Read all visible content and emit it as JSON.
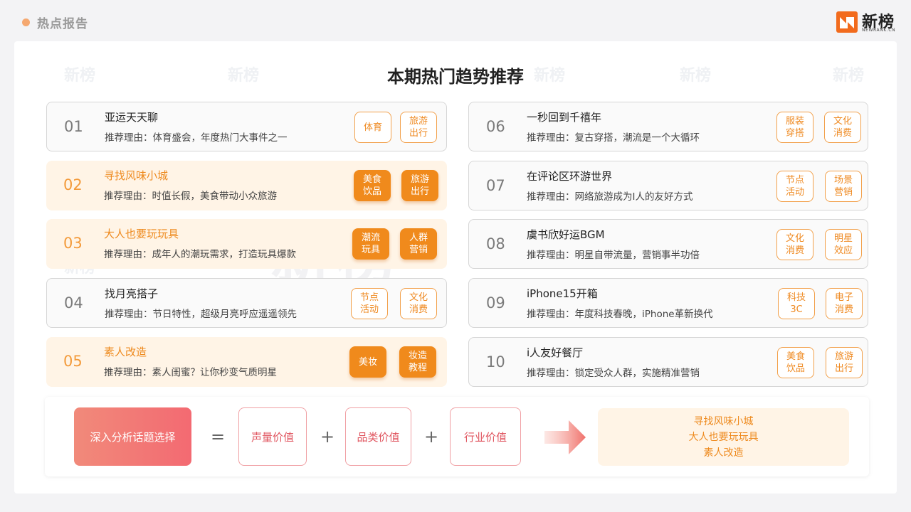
{
  "header": {
    "report_label": "热点报告",
    "logo_cn": "新榜",
    "logo_en": "NEWRANK.CN"
  },
  "watermark": "新榜",
  "title": "本期热门趋势推荐",
  "left_items": [
    {
      "num": "01",
      "topic": "亚运天天聊",
      "reason": "推荐理由：体育盛会，年度热门大事件之一",
      "highlight": false,
      "tags": [
        "体育",
        "旅游\n出行"
      ]
    },
    {
      "num": "02",
      "topic": "寻找风味小城",
      "reason": "推荐理由：时值长假，美食带动小众旅游",
      "highlight": true,
      "tags": [
        "美食\n饮品",
        "旅游\n出行"
      ]
    },
    {
      "num": "03",
      "topic": "大人也要玩玩具",
      "reason": "推荐理由：成年人的潮玩需求，打造玩具爆款",
      "highlight": true,
      "tags": [
        "潮流\n玩具",
        "人群\n营销"
      ]
    },
    {
      "num": "04",
      "topic": "找月亮搭子",
      "reason": "推荐理由：节日特性，超级月亮呼应遥遥领先",
      "highlight": false,
      "tags": [
        "节点\n活动",
        "文化\n消费"
      ]
    },
    {
      "num": "05",
      "topic": "素人改造",
      "reason": "推荐理由：素人闺蜜？让你秒变气质明星",
      "highlight": true,
      "tags": [
        "美妆",
        "妆造\n教程"
      ]
    }
  ],
  "right_items": [
    {
      "num": "06",
      "topic": "一秒回到千禧年",
      "reason": "推荐理由：复古穿搭，潮流是一个大循环",
      "highlight": false,
      "tags": [
        "服装\n穿搭",
        "文化\n消费"
      ]
    },
    {
      "num": "07",
      "topic": "在评论区环游世界",
      "reason": "推荐理由：网络旅游成为I人的友好方式",
      "highlight": false,
      "tags": [
        "节点\n活动",
        "场景\n营销"
      ]
    },
    {
      "num": "08",
      "topic": "虞书欣好运BGM",
      "reason": "推荐理由：明星自带流量，营销事半功倍",
      "highlight": false,
      "tags": [
        "文化\n消费",
        "明星\n效应"
      ]
    },
    {
      "num": "09",
      "topic": "iPhone15开箱",
      "reason": "推荐理由：年度科技春晚，iPhone革新换代",
      "highlight": false,
      "tags": [
        "科技\n3C",
        "电子\n消费"
      ]
    },
    {
      "num": "10",
      "topic": "i人友好餐厅",
      "reason": "推荐理由：锁定受众人群，实施精准营销",
      "highlight": false,
      "tags": [
        "美食\n饮品",
        "旅游\n出行"
      ]
    }
  ],
  "formula": {
    "analyze": "深入分析话题选择",
    "equals": "=",
    "plus": "+",
    "values": [
      "声量价值",
      "品类价值",
      "行业价值"
    ],
    "results": [
      "寻找风味小城",
      "大人也要玩玩具",
      "素人改造"
    ]
  },
  "colors": {
    "accent": "#f08a1c",
    "highlight_bg": "#fff4e6",
    "pink": "#f36a72"
  }
}
